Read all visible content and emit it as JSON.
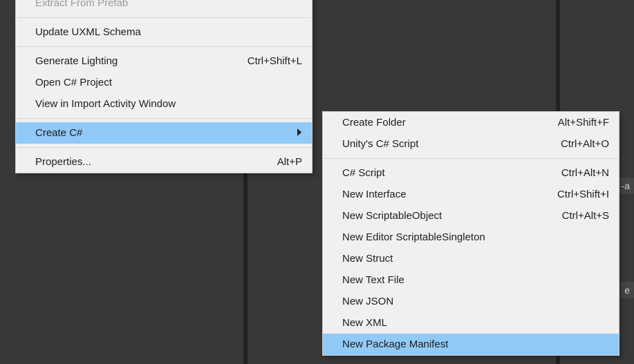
{
  "background": {
    "fragment1": "-a",
    "fragment2": "e"
  },
  "mainMenu": {
    "items": [
      {
        "label": "Extract From Prefab",
        "shortcut": "",
        "submenu": false,
        "disabled": true
      },
      {
        "sep": true
      },
      {
        "label": "Update UXML Schema",
        "shortcut": "",
        "submenu": false
      },
      {
        "sep": true
      },
      {
        "label": "Generate Lighting",
        "shortcut": "Ctrl+Shift+L",
        "submenu": false
      },
      {
        "label": "Open C# Project",
        "shortcut": "",
        "submenu": false
      },
      {
        "label": "View in Import Activity Window",
        "shortcut": "",
        "submenu": false
      },
      {
        "sep": true
      },
      {
        "label": "Create C#",
        "shortcut": "",
        "submenu": true,
        "highlight": true
      },
      {
        "sep": true
      },
      {
        "label": "Properties...",
        "shortcut": "Alt+P",
        "submenu": false
      }
    ]
  },
  "subMenu": {
    "items": [
      {
        "label": "Create Folder",
        "shortcut": "Alt+Shift+F"
      },
      {
        "label": "Unity's C# Script",
        "shortcut": "Ctrl+Alt+O"
      },
      {
        "sep": true
      },
      {
        "label": "C# Script",
        "shortcut": "Ctrl+Alt+N"
      },
      {
        "label": "New Interface",
        "shortcut": "Ctrl+Shift+I"
      },
      {
        "label": "New ScriptableObject",
        "shortcut": "Ctrl+Alt+S"
      },
      {
        "label": "New Editor ScriptableSingleton",
        "shortcut": ""
      },
      {
        "label": "New Struct",
        "shortcut": ""
      },
      {
        "label": "New Text File",
        "shortcut": ""
      },
      {
        "label": "New JSON",
        "shortcut": ""
      },
      {
        "label": "New XML",
        "shortcut": ""
      },
      {
        "label": "New Package Manifest",
        "shortcut": "",
        "highlight": true
      }
    ]
  }
}
